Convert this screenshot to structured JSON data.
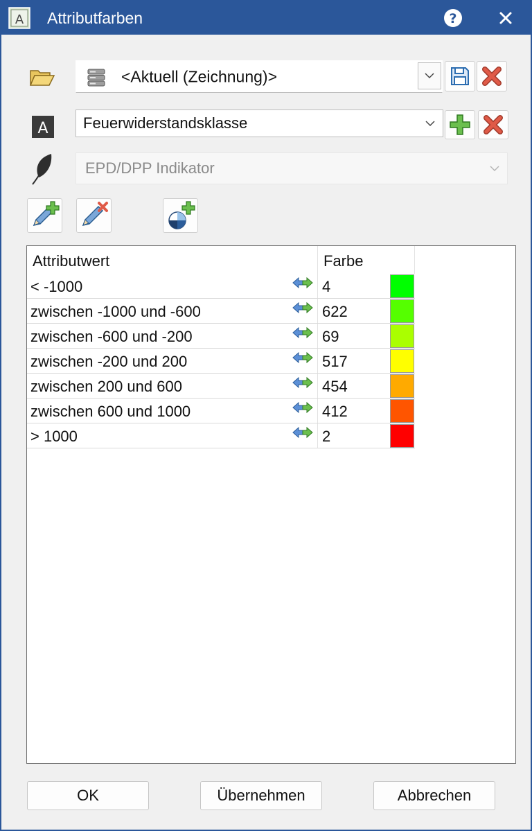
{
  "window": {
    "title": "Attributfarben"
  },
  "library": {
    "value": "<Aktuell (Zeichnung)>"
  },
  "attribute": {
    "value": "Feuerwiderstandsklasse"
  },
  "indicator": {
    "value": "EPD/DPP Indikator"
  },
  "table": {
    "headers": {
      "attribute_value": "Attributwert",
      "color": "Farbe"
    },
    "rows": [
      {
        "label": "< -1000",
        "color_index": "4",
        "color": "#00ff00"
      },
      {
        "label": "zwischen -1000 und -600",
        "color_index": "622",
        "color": "#55ff00"
      },
      {
        "label": "zwischen -600 und -200",
        "color_index": "69",
        "color": "#aaff00"
      },
      {
        "label": "zwischen -200 und 200",
        "color_index": "517",
        "color": "#ffff00"
      },
      {
        "label": "zwischen 200 und 600",
        "color_index": "454",
        "color": "#ffaa00"
      },
      {
        "label": "zwischen 600 und 1000",
        "color_index": "412",
        "color": "#ff5500"
      },
      {
        "label": "> 1000",
        "color_index": "2",
        "color": "#ff0000"
      }
    ]
  },
  "buttons": {
    "ok": "OK",
    "apply": "Übernehmen",
    "cancel": "Abbrechen"
  },
  "colors": {
    "titlebar": "#2b579a",
    "add_green": "#6bbf4e",
    "delete_red": "#d9534f"
  }
}
